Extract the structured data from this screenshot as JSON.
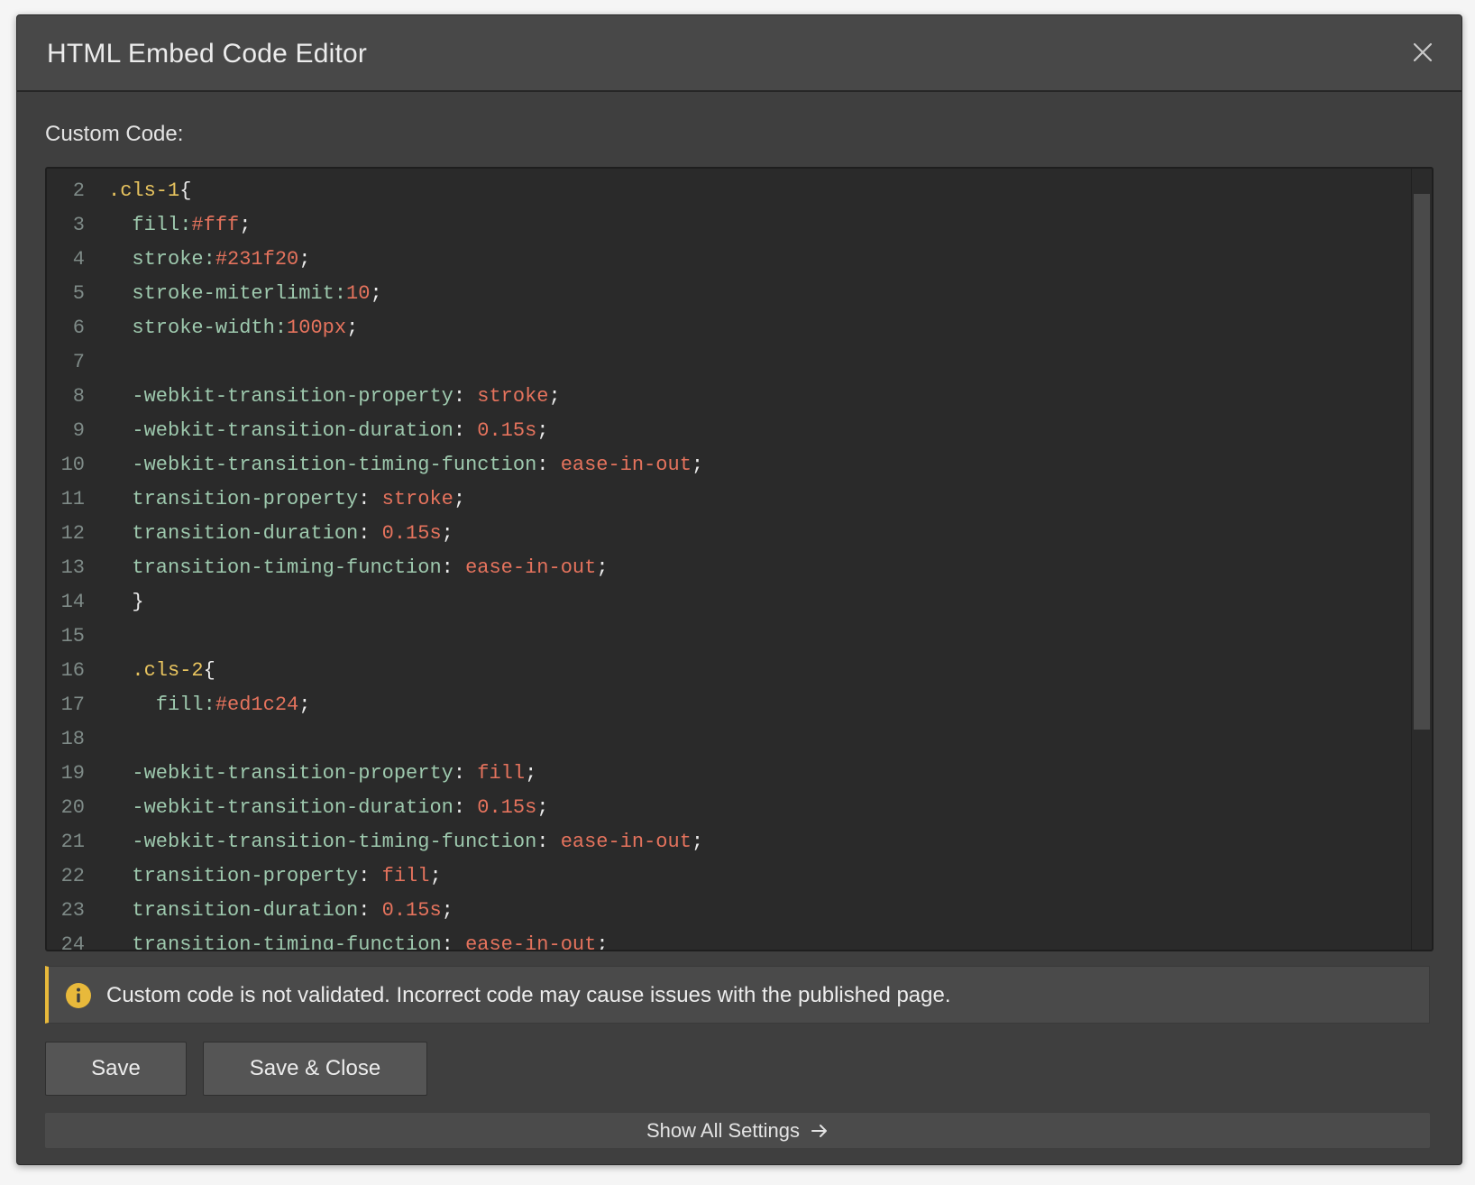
{
  "dialog": {
    "title": "HTML Embed Code Editor",
    "close_icon": "close-icon"
  },
  "editor": {
    "label": "Custom Code:",
    "lines": [
      {
        "n": "2",
        "tokens": [
          {
            "c": "sel",
            "t": ".cls-1"
          },
          {
            "c": "punc",
            "t": "{"
          }
        ]
      },
      {
        "n": "3",
        "tokens": [
          {
            "c": "prop",
            "t": "  fill:"
          },
          {
            "c": "val",
            "t": "#fff"
          },
          {
            "c": "punc",
            "t": ";"
          }
        ]
      },
      {
        "n": "4",
        "tokens": [
          {
            "c": "prop",
            "t": "  stroke:"
          },
          {
            "c": "val",
            "t": "#231f20"
          },
          {
            "c": "punc",
            "t": ";"
          }
        ]
      },
      {
        "n": "5",
        "tokens": [
          {
            "c": "prop",
            "t": "  stroke-miterlimit:"
          },
          {
            "c": "val",
            "t": "10"
          },
          {
            "c": "punc",
            "t": ";"
          }
        ]
      },
      {
        "n": "6",
        "tokens": [
          {
            "c": "prop",
            "t": "  stroke-width:"
          },
          {
            "c": "val",
            "t": "100px"
          },
          {
            "c": "punc",
            "t": ";"
          }
        ]
      },
      {
        "n": "7",
        "tokens": []
      },
      {
        "n": "8",
        "tokens": [
          {
            "c": "prop",
            "t": "  -webkit-transition-property"
          },
          {
            "c": "punc",
            "t": ": "
          },
          {
            "c": "val",
            "t": "stroke"
          },
          {
            "c": "punc",
            "t": ";"
          }
        ]
      },
      {
        "n": "9",
        "tokens": [
          {
            "c": "prop",
            "t": "  -webkit-transition-duration"
          },
          {
            "c": "punc",
            "t": ": "
          },
          {
            "c": "val",
            "t": "0.15s"
          },
          {
            "c": "punc",
            "t": ";"
          }
        ]
      },
      {
        "n": "10",
        "tokens": [
          {
            "c": "prop",
            "t": "  -webkit-transition-timing-function"
          },
          {
            "c": "punc",
            "t": ": "
          },
          {
            "c": "val",
            "t": "ease-in-out"
          },
          {
            "c": "punc",
            "t": ";"
          }
        ]
      },
      {
        "n": "11",
        "tokens": [
          {
            "c": "prop",
            "t": "  transition-property"
          },
          {
            "c": "punc",
            "t": ": "
          },
          {
            "c": "val",
            "t": "stroke"
          },
          {
            "c": "punc",
            "t": ";"
          }
        ]
      },
      {
        "n": "12",
        "tokens": [
          {
            "c": "prop",
            "t": "  transition-duration"
          },
          {
            "c": "punc",
            "t": ": "
          },
          {
            "c": "val",
            "t": "0.15s"
          },
          {
            "c": "punc",
            "t": ";"
          }
        ]
      },
      {
        "n": "13",
        "tokens": [
          {
            "c": "prop",
            "t": "  transition-timing-function"
          },
          {
            "c": "punc",
            "t": ": "
          },
          {
            "c": "val",
            "t": "ease-in-out"
          },
          {
            "c": "punc",
            "t": ";"
          }
        ]
      },
      {
        "n": "14",
        "tokens": [
          {
            "c": "punc",
            "t": "  }"
          }
        ]
      },
      {
        "n": "15",
        "tokens": []
      },
      {
        "n": "16",
        "tokens": [
          {
            "c": "sel",
            "t": "  .cls-2"
          },
          {
            "c": "punc",
            "t": "{"
          }
        ]
      },
      {
        "n": "17",
        "tokens": [
          {
            "c": "prop",
            "t": "    fill:"
          },
          {
            "c": "val",
            "t": "#ed1c24"
          },
          {
            "c": "punc",
            "t": ";"
          }
        ]
      },
      {
        "n": "18",
        "tokens": []
      },
      {
        "n": "19",
        "tokens": [
          {
            "c": "prop",
            "t": "  -webkit-transition-property"
          },
          {
            "c": "punc",
            "t": ": "
          },
          {
            "c": "val",
            "t": "fill"
          },
          {
            "c": "punc",
            "t": ";"
          }
        ]
      },
      {
        "n": "20",
        "tokens": [
          {
            "c": "prop",
            "t": "  -webkit-transition-duration"
          },
          {
            "c": "punc",
            "t": ": "
          },
          {
            "c": "val",
            "t": "0.15s"
          },
          {
            "c": "punc",
            "t": ";"
          }
        ]
      },
      {
        "n": "21",
        "tokens": [
          {
            "c": "prop",
            "t": "  -webkit-transition-timing-function"
          },
          {
            "c": "punc",
            "t": ": "
          },
          {
            "c": "val",
            "t": "ease-in-out"
          },
          {
            "c": "punc",
            "t": ";"
          }
        ]
      },
      {
        "n": "22",
        "tokens": [
          {
            "c": "prop",
            "t": "  transition-property"
          },
          {
            "c": "punc",
            "t": ": "
          },
          {
            "c": "val",
            "t": "fill"
          },
          {
            "c": "punc",
            "t": ";"
          }
        ]
      },
      {
        "n": "23",
        "tokens": [
          {
            "c": "prop",
            "t": "  transition-duration"
          },
          {
            "c": "punc",
            "t": ": "
          },
          {
            "c": "val",
            "t": "0.15s"
          },
          {
            "c": "punc",
            "t": ";"
          }
        ]
      },
      {
        "n": "24",
        "tokens": [
          {
            "c": "prop",
            "t": "  transition-timing-function"
          },
          {
            "c": "punc",
            "t": ": "
          },
          {
            "c": "val",
            "t": "ease-in-out"
          },
          {
            "c": "punc",
            "t": ";"
          }
        ]
      }
    ]
  },
  "notice": {
    "icon": "info-icon",
    "text": "Custom code is not validated. Incorrect code may cause issues with the published page."
  },
  "buttons": {
    "save": "Save",
    "save_close": "Save & Close"
  },
  "settings_link": {
    "label": "Show All Settings",
    "icon": "arrow-right-icon"
  },
  "colors": {
    "accent_warning": "#e8b93b",
    "selector": "#e8c45f",
    "property": "#9ec9ae",
    "value": "#e5735d"
  }
}
